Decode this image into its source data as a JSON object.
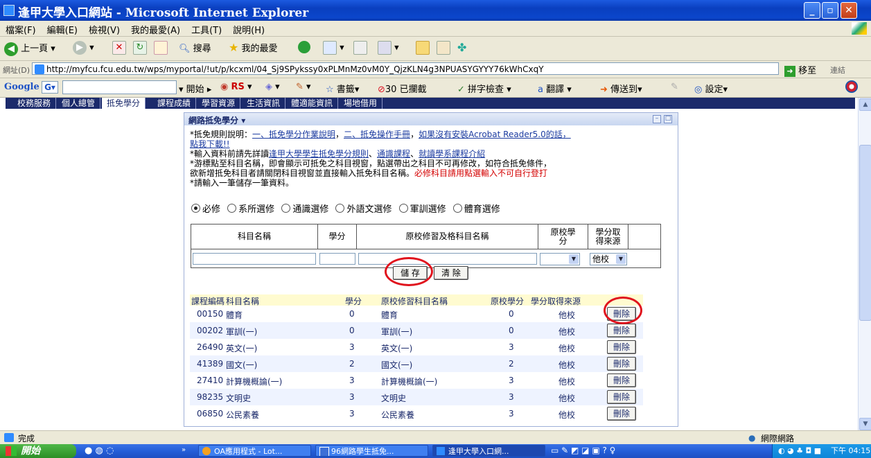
{
  "window": {
    "title": "逢甲大學入口網站 - Microsoft Internet Explorer"
  },
  "menu": [
    "檔案(F)",
    "編輯(E)",
    "檢視(V)",
    "我的最愛(A)",
    "工具(T)",
    "說明(H)"
  ],
  "toolbar": {
    "back": "上一頁",
    "search": "搜尋",
    "favorites": "我的最愛"
  },
  "address": {
    "label": "網址(D)",
    "url": "http://myfcu.fcu.edu.tw/wps/myportal/!ut/p/kcxml/04_Sj9SPykssy0xPLMnMz0vM0Y_QjzKLN4g3NPUASYGYYY76kWhCxqY",
    "go": "移至",
    "links": "連結"
  },
  "google": {
    "logo": "Google",
    "start": "開始",
    "rs": "RS",
    "bookmarks": "書籤",
    "blocked": "30 已攔截",
    "spell": "拼字檢查",
    "translate": "翻譯",
    "send": "傳送到",
    "settings": "設定"
  },
  "portal_nav": [
    "校務服務",
    "個人總管",
    "抵免學分",
    "課程成績",
    "學習資源",
    "生活資訊",
    "體適能資訊",
    "場地借用"
  ],
  "portlet": {
    "title": "網路抵免學分",
    "line1_prefix": "*抵免規則說明：",
    "line1_link1": "一、抵免學分作業說明",
    "line1_sep": "，",
    "line1_link2": "二、抵免操作手冊",
    "line1_mid": "，",
    "line1_link3": "如果沒有安裝Acrobat Reader5.0的話，",
    "line1_link4": "點我下載!!",
    "line2_prefix": "*輸入資料前請先詳讀",
    "line2_link1": "逢甲大學學生抵免學分規則",
    "line2_sep1": "、",
    "line2_link2": "通識課程",
    "line2_sep2": "、",
    "line2_link3": "就讀學系課程介紹",
    "line3": "*游標點至科目名稱，即會顯示可抵免之科目視窗，點選帶出之科目不可再修改，如符合抵免條件，",
    "line4_black": "欲新增抵免科目者請關閉科目視窗並直接輸入抵免科目名稱。",
    "line4_red": "必修科目請用點選輸入不可自行登打",
    "line5": "*請輸入一筆儲存一筆資料。"
  },
  "radios": [
    {
      "label": "必修",
      "checked": true
    },
    {
      "label": "系所選修",
      "checked": false
    },
    {
      "label": "通識選修",
      "checked": false
    },
    {
      "label": "外語文選修",
      "checked": false
    },
    {
      "label": "軍訓選修",
      "checked": false
    },
    {
      "label": "體育選修",
      "checked": false
    }
  ],
  "input_table": {
    "headers": [
      "科目名稱",
      "學分",
      "原校修習及格科目名稱",
      "原校學分",
      "學分取得來源"
    ],
    "source_value": "他校"
  },
  "buttons": {
    "save": "儲 存",
    "clear": "清 除"
  },
  "list": {
    "headers": [
      "課程編碼",
      "科目名稱",
      "學分",
      "原校修習科目名稱",
      "原校學分",
      "學分取得來源"
    ],
    "delete_label": "刪除",
    "rows": [
      {
        "code": "00150",
        "name": "體育",
        "credit": "0",
        "orig_name": "體育",
        "orig_credit": "0",
        "source": "他校"
      },
      {
        "code": "00202",
        "name": "軍訓(一)",
        "credit": "0",
        "orig_name": "軍訓(一)",
        "orig_credit": "0",
        "source": "他校"
      },
      {
        "code": "26490",
        "name": "英文(一)",
        "credit": "3",
        "orig_name": "英文(一)",
        "orig_credit": "3",
        "source": "他校"
      },
      {
        "code": "41389",
        "name": "國文(一)",
        "credit": "2",
        "orig_name": "國文(一)",
        "orig_credit": "2",
        "source": "他校"
      },
      {
        "code": "27410",
        "name": "計算機概論(一)",
        "credit": "3",
        "orig_name": "計算機概論(一)",
        "orig_credit": "3",
        "source": "他校"
      },
      {
        "code": "98235",
        "name": "文明史",
        "credit": "3",
        "orig_name": "文明史",
        "orig_credit": "3",
        "source": "他校"
      },
      {
        "code": "06850",
        "name": "公民素養",
        "credit": "3",
        "orig_name": "公民素養",
        "orig_credit": "3",
        "source": "他校"
      }
    ]
  },
  "status": {
    "text": "完成",
    "zone": "網際網路"
  },
  "taskbar": {
    "start": "開始",
    "tasks": [
      "OA應用程式 - Lot...",
      "96網路學生抵免...",
      "逢甲大學入口網..."
    ],
    "clock": "下午 04:15"
  }
}
